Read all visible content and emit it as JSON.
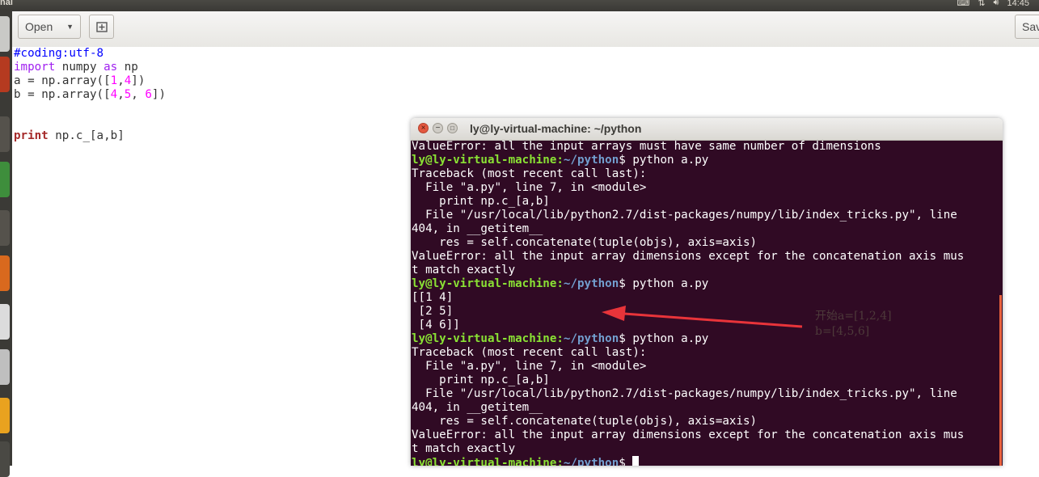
{
  "top_panel": {
    "app_name": "nal",
    "clock": "14:45"
  },
  "toolbar": {
    "open_label": "Open",
    "save_label": "Sav"
  },
  "editor": {
    "lines": [
      "#coding:utf-8",
      "import numpy as np",
      "a = np.array([1,4])",
      "b = np.array([4,5, 6])",
      "",
      "",
      "print np.c_[a,b]"
    ]
  },
  "terminal": {
    "title": "ly@ly-virtual-machine: ~/python",
    "prompt_user": "ly@ly-virtual-machine",
    "prompt_path": "~/python",
    "lines": [
      {
        "type": "out",
        "text": "ValueError: all the input arrays must have same number of dimensions"
      },
      {
        "type": "prompt",
        "cmd": " python a.py"
      },
      {
        "type": "out",
        "text": "Traceback (most recent call last):"
      },
      {
        "type": "out",
        "text": "  File \"a.py\", line 7, in <module>"
      },
      {
        "type": "out",
        "text": "    print np.c_[a,b]"
      },
      {
        "type": "out",
        "text": "  File \"/usr/local/lib/python2.7/dist-packages/numpy/lib/index_tricks.py\", line"
      },
      {
        "type": "out",
        "text": "404, in __getitem__"
      },
      {
        "type": "out",
        "text": "    res = self.concatenate(tuple(objs), axis=axis)"
      },
      {
        "type": "out",
        "text": "ValueError: all the input array dimensions except for the concatenation axis mus"
      },
      {
        "type": "out",
        "text": "t match exactly"
      },
      {
        "type": "prompt",
        "cmd": " python a.py"
      },
      {
        "type": "out",
        "text": "[[1 4]"
      },
      {
        "type": "out",
        "text": " [2 5]"
      },
      {
        "type": "out",
        "text": " [4 6]]"
      },
      {
        "type": "prompt",
        "cmd": " python a.py"
      },
      {
        "type": "out",
        "text": "Traceback (most recent call last):"
      },
      {
        "type": "out",
        "text": "  File \"a.py\", line 7, in <module>"
      },
      {
        "type": "out",
        "text": "    print np.c_[a,b]"
      },
      {
        "type": "out",
        "text": "  File \"/usr/local/lib/python2.7/dist-packages/numpy/lib/index_tricks.py\", line"
      },
      {
        "type": "out",
        "text": "404, in __getitem__"
      },
      {
        "type": "out",
        "text": "    res = self.concatenate(tuple(objs), axis=axis)"
      },
      {
        "type": "out",
        "text": "ValueError: all the input array dimensions except for the concatenation axis mus"
      },
      {
        "type": "out",
        "text": "t match exactly"
      },
      {
        "type": "prompt",
        "cmd": " ",
        "cursor": true
      }
    ]
  },
  "annotation": {
    "line1": "开始a=[1,2,4]",
    "line2": "b=[4,5,6]",
    "arrow_color": "#e8343a"
  },
  "colors": {
    "terminal_bg": "#300a24",
    "prompt_user": "#8ae234",
    "prompt_path": "#729fcf"
  }
}
